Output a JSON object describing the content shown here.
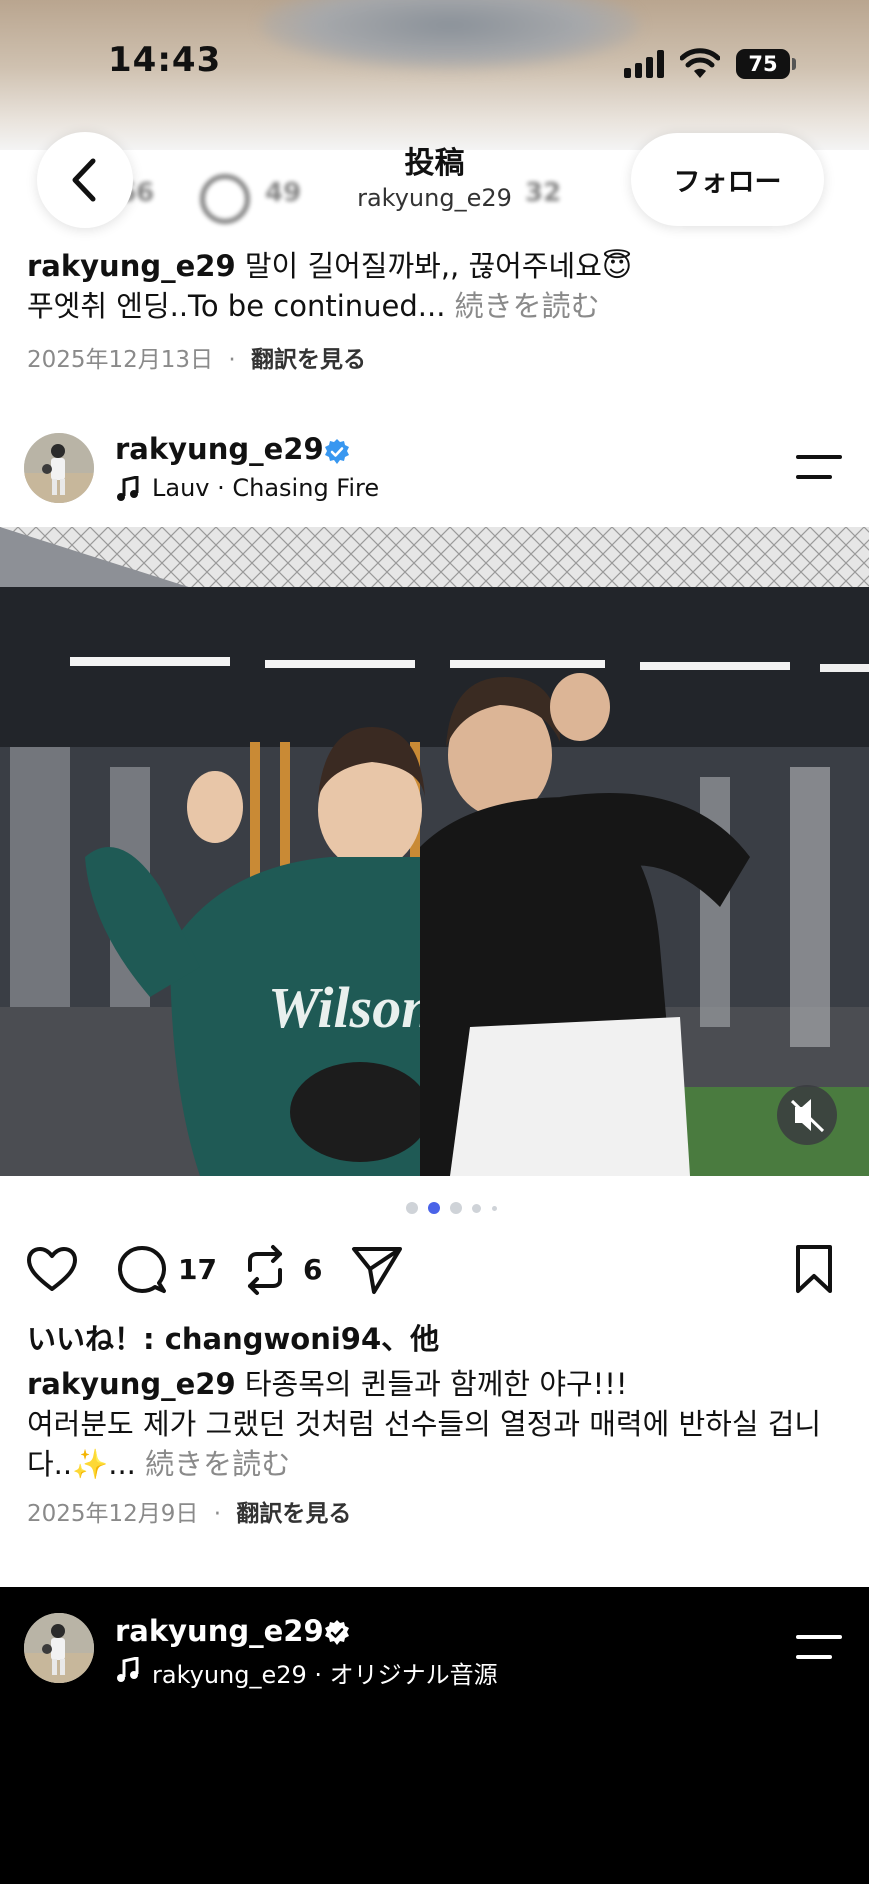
{
  "status_bar": {
    "time": "14:43",
    "battery": "75"
  },
  "header": {
    "title": "投稿",
    "subtitle": "rakyung_e29",
    "follow_label": "フォロー",
    "blurred_counts": [
      "366",
      "49",
      "32"
    ]
  },
  "prev_post": {
    "username": "rakyung_e29",
    "caption_line1": "말이 길어질까봐,, 끊어주네요😇",
    "caption_line2": "푸엣취 엔딩..To be continued...",
    "more_label": "続きを読む",
    "date": "2025年12月13日",
    "translate_label": "翻訳を見る"
  },
  "post": {
    "username": "rakyung_e29",
    "verified": true,
    "music": "Lauv · Chasing Fire",
    "carousel_total": 5,
    "carousel_active": 2,
    "comments": "17",
    "reposts": "6",
    "likes_text": "いいね！: changwoni94、他",
    "caption_user": "rakyung_e29",
    "caption_line1": "타종목의 퀸들과 함께한 야구!!!",
    "caption_line2": "여러분도 제가 그랬던 것처럼 선수들의 열정과 매력에 반하실 겁니",
    "caption_line3": "다..✨...",
    "more_label": "続きを読む",
    "date": "2025年12月9日",
    "translate_label": "翻訳を見る",
    "jacket_text": "Wilson"
  },
  "next_post": {
    "username": "rakyung_e29",
    "verified": true,
    "music": "rakyung_e29 · オリジナル音源"
  },
  "colors": {
    "verified_blue": "#3897f0",
    "active_dot": "#4a63e8"
  }
}
